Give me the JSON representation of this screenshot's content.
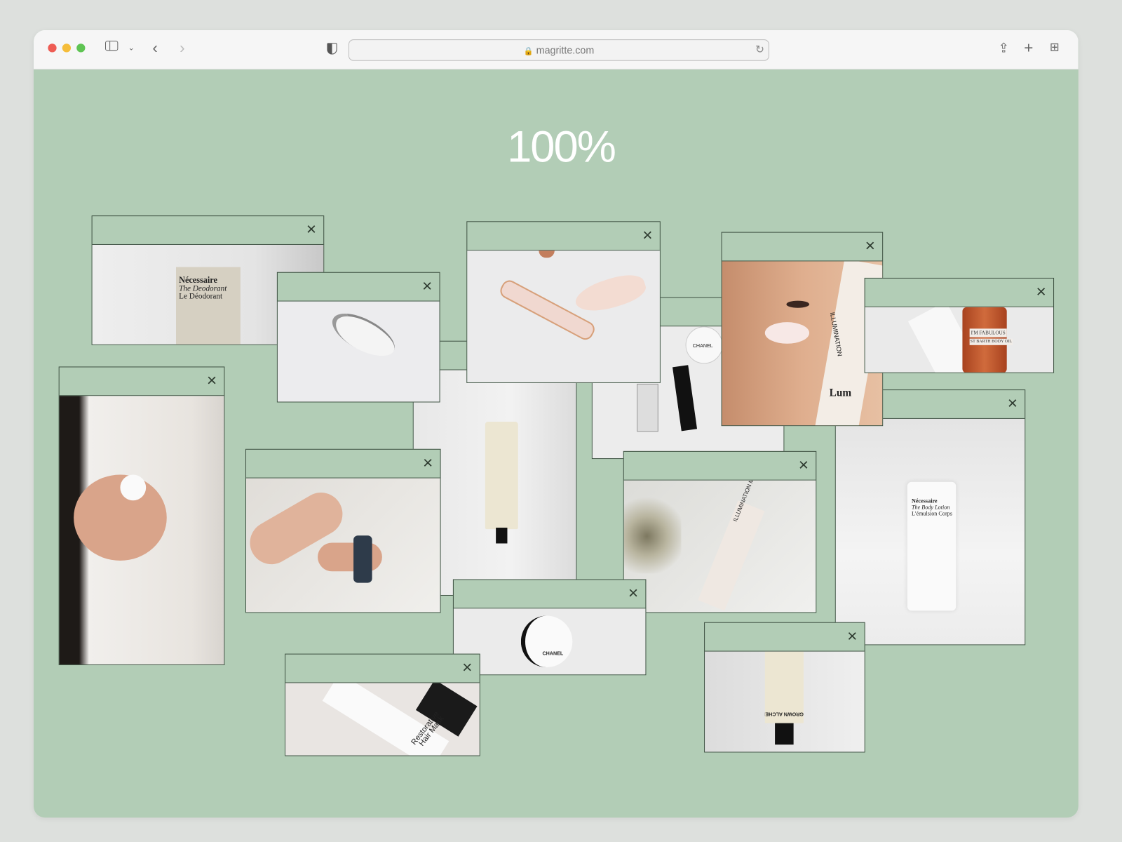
{
  "browser": {
    "url": "magritte.com",
    "traffic_lights": {
      "close": "#ee5c54",
      "minimize": "#f5bd3a",
      "maximize": "#5fc453"
    },
    "icons": [
      "sidebar-icon",
      "chevron-down-icon",
      "back-icon",
      "forward-icon",
      "shield-icon",
      "lock-icon",
      "reload-icon",
      "share-icon",
      "new-tab-icon",
      "tab-overview-icon"
    ]
  },
  "page": {
    "progress_label": "100%",
    "background": "#b2cdb6",
    "window_border": "#3f5243"
  },
  "windows": [
    {
      "name": "deodorant",
      "close": "×",
      "label": [
        "Nécessaire",
        "The Deodorant",
        "Le Déodorant"
      ]
    },
    {
      "name": "cream-swatch",
      "close": "×"
    },
    {
      "name": "tube-standing",
      "close": "×"
    },
    {
      "name": "chanel-products",
      "close": "×",
      "label": [
        "CHANEL"
      ]
    },
    {
      "name": "hands-cream",
      "close": "×"
    },
    {
      "name": "dropper-bottle",
      "close": "×"
    },
    {
      "name": "rose-quartz-roller",
      "close": "×"
    },
    {
      "name": "body-lotion",
      "close": "×",
      "label": [
        "Nécessaire",
        "The Body Lotion",
        "L'émulsion Corps"
      ]
    },
    {
      "name": "face-illumination",
      "close": "×",
      "label": [
        "ILLUMINATION",
        "Lum"
      ]
    },
    {
      "name": "body-oil",
      "close": "×",
      "label": [
        "I'M FABULOUS",
        "ST BARTH BODY OIL"
      ]
    },
    {
      "name": "illumination-mask",
      "close": "×",
      "label": [
        "ILLUMINATION MASK"
      ]
    },
    {
      "name": "chanel-jar",
      "close": "×",
      "label": [
        "CHANEL"
      ]
    },
    {
      "name": "hair-mask",
      "close": "×",
      "label": [
        "Restorative",
        "Hair Mask"
      ]
    },
    {
      "name": "grown-alchemist-tube",
      "close": "×",
      "label": [
        "GROWN ALCHEM"
      ]
    }
  ]
}
